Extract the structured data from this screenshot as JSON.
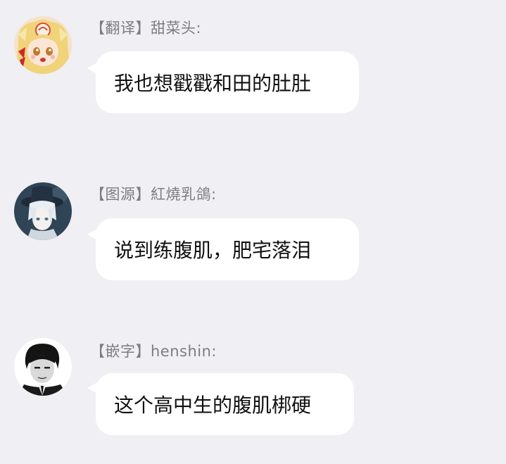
{
  "messages": [
    {
      "avatar_icon": "anime-girl-avatar-icon",
      "sender": "【翻译】甜菜头:",
      "text": "我也想戳戳和田的肚肚"
    },
    {
      "avatar_icon": "white-hair-hat-boy-avatar-icon",
      "sender": "【图源】紅燒乳鴿:",
      "text": "说到练腹肌，肥宅落泪"
    },
    {
      "avatar_icon": "dark-suit-man-avatar-icon",
      "sender": "【嵌字】henshin:",
      "text": "这个高中生的腹肌梆硬"
    }
  ],
  "colors": {
    "background": "#efeff4",
    "bubble": "#ffffff",
    "sender_text": "#7c7c82",
    "message_text": "#111111"
  }
}
